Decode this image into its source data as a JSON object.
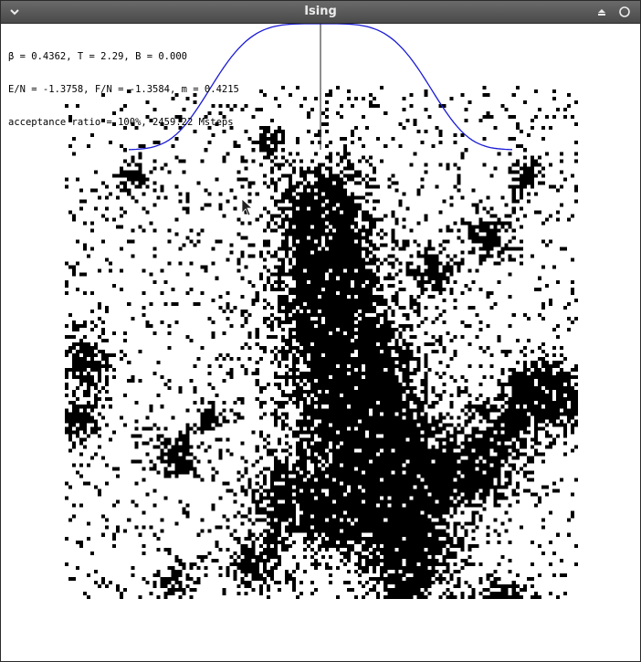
{
  "window": {
    "title": "Ising"
  },
  "stats": {
    "line1": "β = 0.4362, T = 2.29, B = 0.000",
    "line2": "E/N = -1.3758, F/N = -1.3584, m = 0.4215",
    "line3": "acceptance ratio = 100%, 2459.22 Msteps"
  },
  "icons": {
    "menu": "chevron-down-icon",
    "shade": "shade-up-icon",
    "close": "close-circle-icon",
    "cursor": "mouse-pointer-icon"
  },
  "colors": {
    "titlebar": "#555555",
    "title_text": "#ececec",
    "spin_up": "#000000",
    "spin_down": "#ffffff",
    "histogram_curve": "#1a1ad6",
    "axis": "#444444"
  }
}
